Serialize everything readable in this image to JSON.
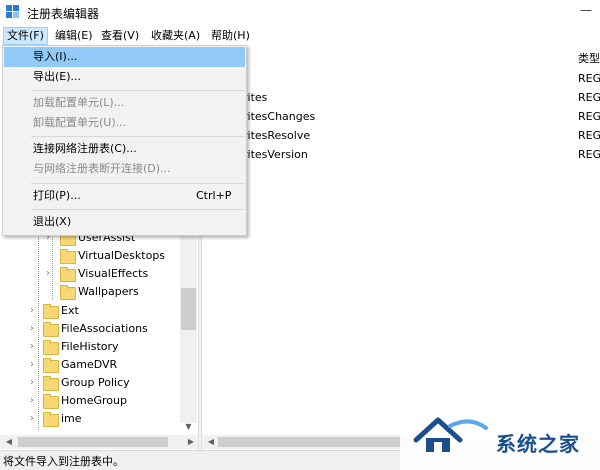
{
  "window": {
    "title": "注册表编辑器",
    "minimize_glyph": "—"
  },
  "menubar": [
    {
      "label": "文件(F)"
    },
    {
      "label": "编辑(E)"
    },
    {
      "label": "查看(V)"
    },
    {
      "label": "收藏夹(A)"
    },
    {
      "label": "帮助(H)"
    }
  ],
  "file_menu": {
    "items": [
      {
        "label": "导入(I)...",
        "state": "selected"
      },
      {
        "label": "导出(E)...",
        "state": "normal"
      },
      {
        "label": "加载配置单元(L)...",
        "state": "disabled"
      },
      {
        "label": "卸载配置单元(U)...",
        "state": "disabled"
      },
      {
        "label": "连接网络注册表(C)...",
        "state": "normal"
      },
      {
        "label": "与网络注册表断开连接(D)...",
        "state": "disabled"
      },
      {
        "label": "打印(P)...",
        "shortcut": "Ctrl+P",
        "state": "normal"
      },
      {
        "label": "退出(X)",
        "state": "normal"
      }
    ]
  },
  "tree": {
    "items": [
      {
        "label": "UserAssist",
        "expandable": true
      },
      {
        "label": "VirtualDesktops",
        "expandable": false
      },
      {
        "label": "VisualEffects",
        "expandable": true
      },
      {
        "label": "Wallpapers",
        "expandable": false
      },
      {
        "label": "Ext",
        "expandable": true
      },
      {
        "label": "FileAssociations",
        "expandable": true
      },
      {
        "label": "FileHistory",
        "expandable": true
      },
      {
        "label": "GameDVR",
        "expandable": true
      },
      {
        "label": "Group Policy",
        "expandable": true
      },
      {
        "label": "HomeGroup",
        "expandable": true
      },
      {
        "label": "ime",
        "expandable": true
      }
    ]
  },
  "list": {
    "type_header": "类型",
    "rows": [
      {
        "name": ")",
        "type": "REG"
      },
      {
        "name": "rites",
        "type": "REG"
      },
      {
        "name": "ritesChanges",
        "type": "REG"
      },
      {
        "name": "ritesResolve",
        "type": "REG"
      },
      {
        "name": "ritesVersion",
        "type": "REG"
      }
    ]
  },
  "status": {
    "text": "将文件导入到注册表中。"
  },
  "watermark": {
    "text": "系统之家"
  },
  "colors": {
    "selection": "#91c9f7",
    "folder": "#f8d775",
    "menu_bg": "#f2f2f2"
  }
}
